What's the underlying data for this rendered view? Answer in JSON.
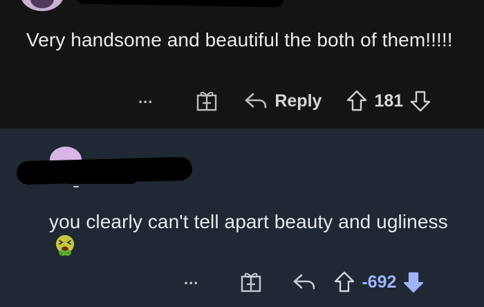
{
  "comments": [
    {
      "body": "Very handsome and beautiful the both of them!!!!!",
      "actions": {
        "more": "...",
        "award_icon": "gift-award-icon",
        "reply_icon": "reply-arrow-icon",
        "reply_label": "Reply",
        "upvote_icon": "upvote-outline-icon",
        "score": "181",
        "downvote_icon": "downvote-outline-icon"
      }
    },
    {
      "body": "you clearly can't tell apart beauty and ugliness",
      "emoji": "nauseated-face",
      "actions": {
        "more": "...",
        "award_icon": "gift-award-icon",
        "reply_icon": "reply-arrow-icon",
        "upvote_icon": "upvote-outline-icon",
        "score": "-692",
        "downvote_icon": "downvote-filled-icon",
        "downvote_state": "active"
      }
    }
  ],
  "colors": {
    "background_top": "#141414",
    "background_bottom": "#202833",
    "downvote_active": "#9db4ff",
    "score_negative": "#9db4ff"
  }
}
